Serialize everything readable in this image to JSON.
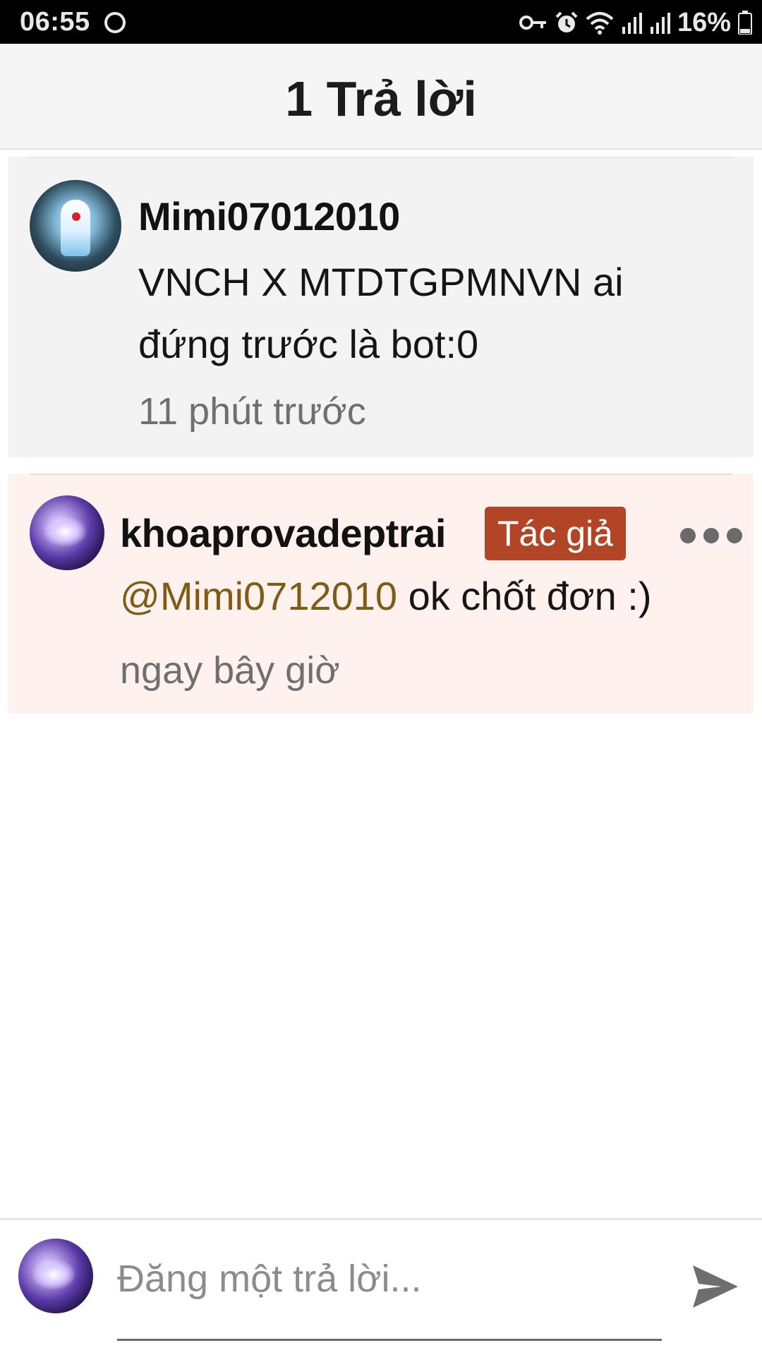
{
  "status_bar": {
    "time": "06:55",
    "battery_percent": "16%",
    "icons": [
      "vpn-key-icon",
      "alarm-icon",
      "wifi-icon",
      "signal-icon",
      "signal-icon",
      "battery-icon"
    ]
  },
  "header": {
    "title": "1 Trả lời"
  },
  "comments": [
    {
      "username": "Mimi07012010",
      "text": "VNCH X MTDTGPMNVN ai đứng trước là bot:0",
      "time": "11 phút trước"
    },
    {
      "username": "khoaprovadeptrai",
      "badge": "Tác giả",
      "mention": "@Mimi0712010",
      "text": " ok chốt đơn :)",
      "time": "ngay bây giờ"
    }
  ],
  "composer": {
    "placeholder": "Đăng một trả lời..."
  },
  "colors": {
    "badge_bg": "#b14526",
    "mention": "#7f5b15",
    "reply_highlight": "#fff2ee",
    "header_bg": "#f5f5f5"
  }
}
